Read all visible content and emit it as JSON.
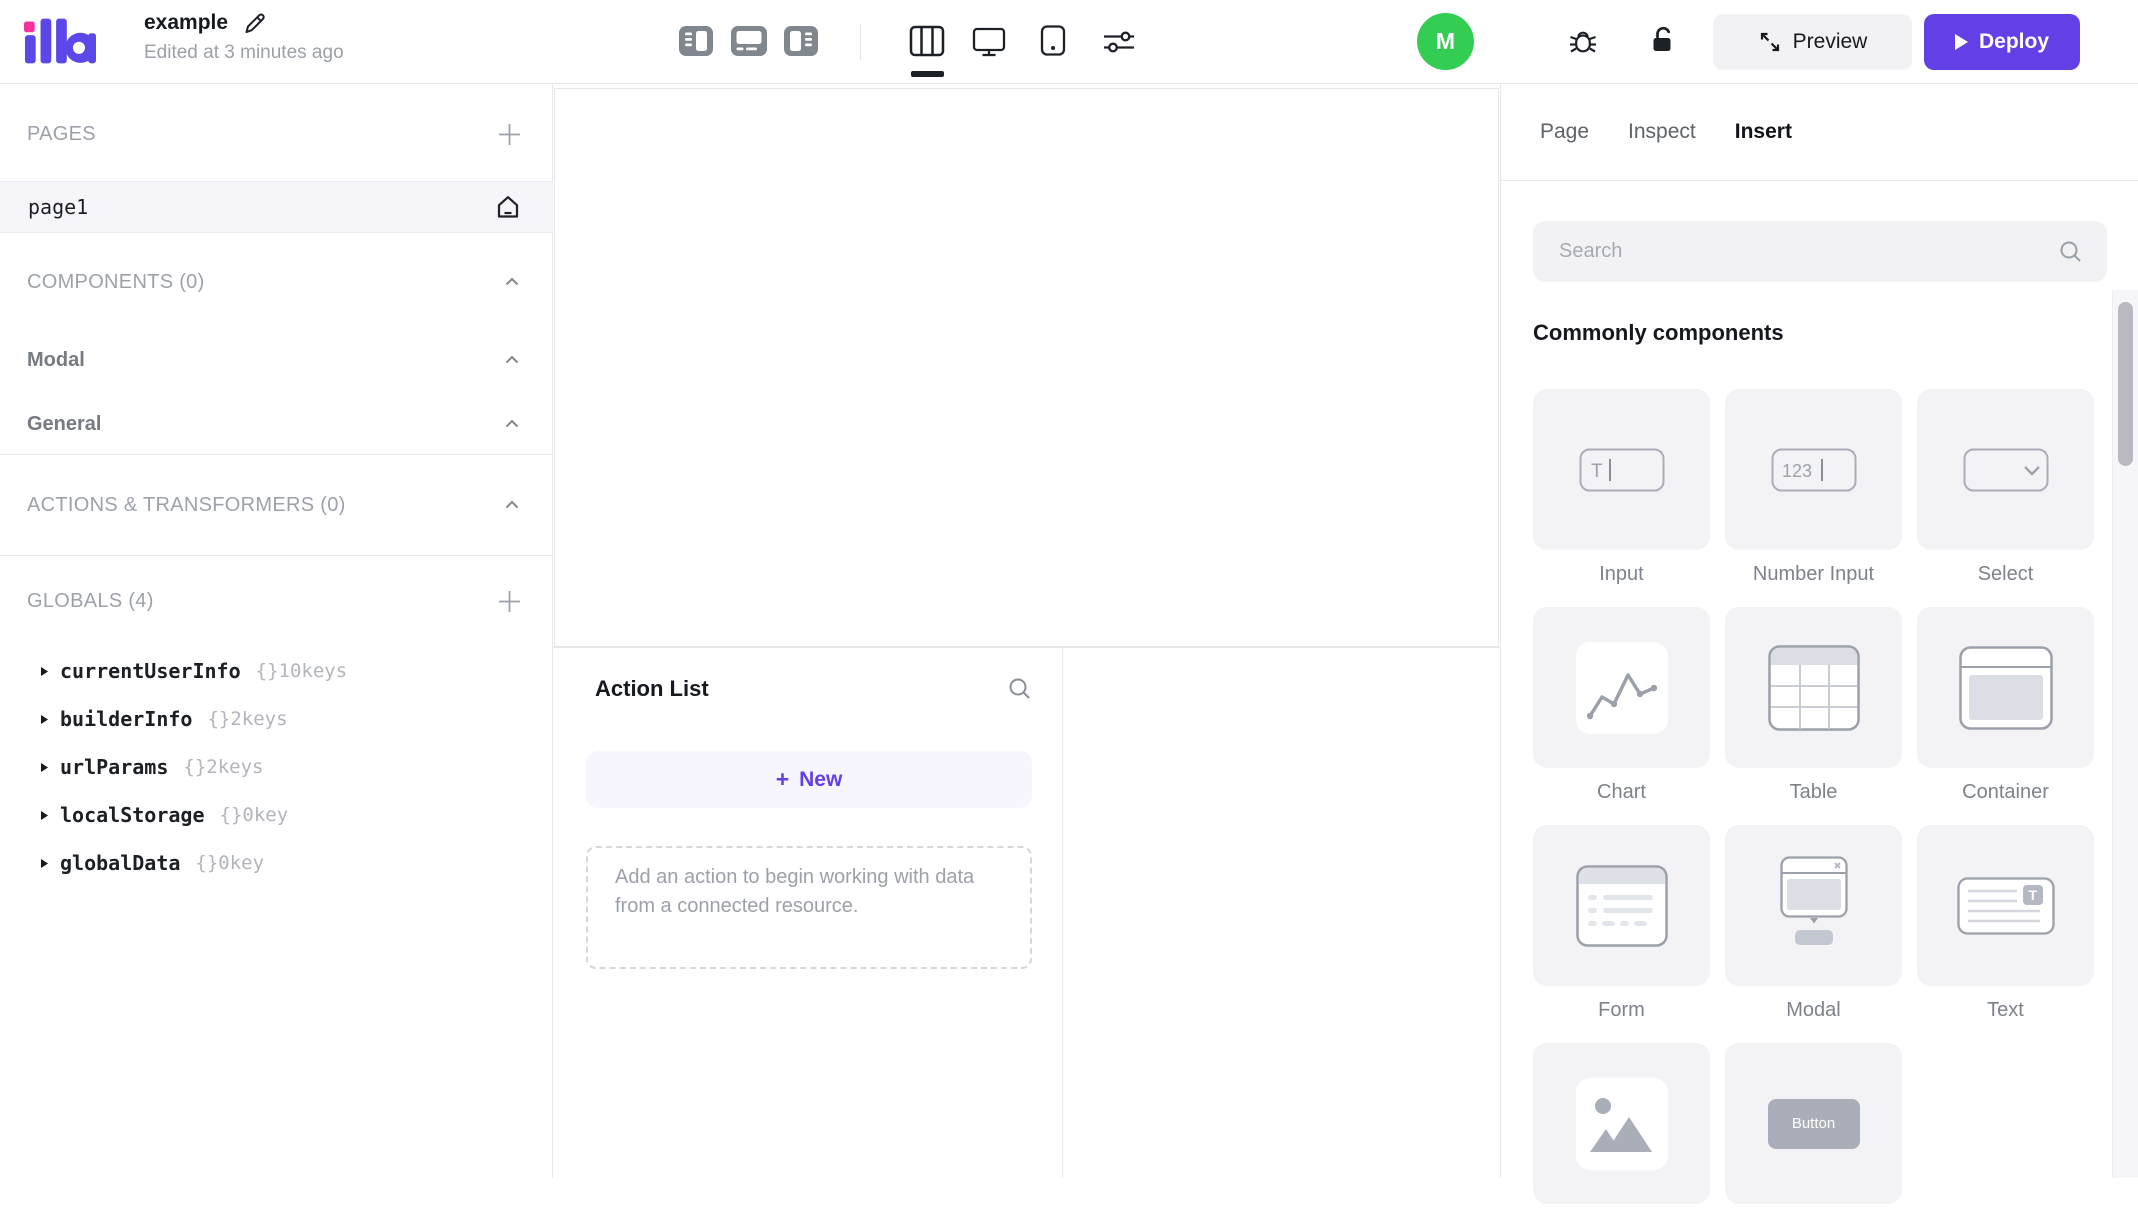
{
  "topbar": {
    "logo_text": "illa",
    "title": "example",
    "edited": "Edited at 3 minutes ago",
    "avatar_initial": "M",
    "preview_label": "Preview",
    "deploy_label": "Deploy"
  },
  "sidebar": {
    "pages_header": "PAGES",
    "page_item": "page1",
    "components_header": "COMPONENTS (0)",
    "component_groups": [
      {
        "label": "Modal"
      },
      {
        "label": "General"
      }
    ],
    "actions_header": "ACTIONS & TRANSFORMERS (0)",
    "globals_header": "GLOBALS (4)",
    "globals": [
      {
        "name": "currentUserInfo",
        "keys": "{}10keys"
      },
      {
        "name": "builderInfo",
        "keys": "{}2keys"
      },
      {
        "name": "urlParams",
        "keys": "{}2keys"
      },
      {
        "name": "localStorage",
        "keys": "{}0key"
      },
      {
        "name": "globalData",
        "keys": "{}0key"
      }
    ]
  },
  "action_panel": {
    "title": "Action List",
    "new_button_plus": "+",
    "new_button": "New",
    "empty_hint": "Add an action to begin working with data from a connected resource."
  },
  "right_panel": {
    "tabs": [
      {
        "label": "Page"
      },
      {
        "label": "Inspect"
      },
      {
        "label": "Insert"
      }
    ],
    "active_tab": "Insert",
    "search_placeholder": "Search",
    "section_title": "Commonly components",
    "icon_texts": {
      "input": "T",
      "number_input": "123"
    },
    "components": [
      {
        "label": "Input"
      },
      {
        "label": "Number Input"
      },
      {
        "label": "Select"
      },
      {
        "label": "Chart"
      },
      {
        "label": "Table"
      },
      {
        "label": "Container"
      },
      {
        "label": "Form"
      },
      {
        "label": "Modal"
      },
      {
        "label": "Text"
      },
      {
        "label": ""
      },
      {
        "label": "",
        "button_text": "Button"
      }
    ]
  },
  "colors": {
    "accent_purple": "#6340e5",
    "avatar_green": "#32cd52",
    "logo_pink": "#f5319d"
  }
}
